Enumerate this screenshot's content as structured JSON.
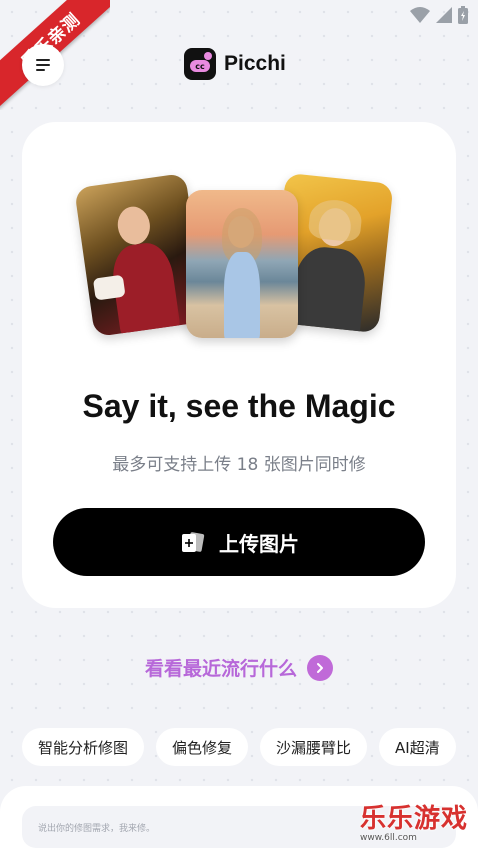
{
  "watermark_corner": {
    "text": "乐乐亲测",
    "color": "#d8262b"
  },
  "header": {
    "brand_name": "Picchi",
    "menu_icon": "hamburger-menu-icon",
    "logo_icon": "picchi-logo-icon"
  },
  "hero": {
    "headline": "Say it, see the Magic",
    "subtitle": "最多可支持上传 18 张图片同时修",
    "upload_label": "上传图片",
    "upload_icon": "image-add-icon"
  },
  "trending": {
    "label": "看看最近流行什么",
    "icon": "chevron-right-icon",
    "color": "#b768d9"
  },
  "chips": [
    "智能分析修图",
    "偏色修复",
    "沙漏腰臂比",
    "AI超清"
  ],
  "prompt": {
    "placeholder": "说出你的修图需求，我来修。"
  },
  "watermark_bottom": {
    "text": "乐乐游戏",
    "url": "www.6ll.com"
  }
}
